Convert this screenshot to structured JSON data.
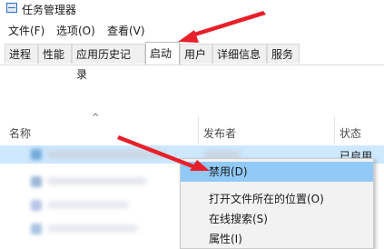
{
  "window": {
    "title": "任务管理器"
  },
  "menu": [
    "文件(F)",
    "选项(O)",
    "查看(V)"
  ],
  "tabs": [
    {
      "label": "进程",
      "active": false
    },
    {
      "label": "性能",
      "active": false
    },
    {
      "label": "应用历史记录",
      "active": false
    },
    {
      "label": "启动",
      "active": true
    },
    {
      "label": "用户",
      "active": false
    },
    {
      "label": "详细信息",
      "active": false
    },
    {
      "label": "服务",
      "active": false
    }
  ],
  "columns": {
    "name": "名称",
    "publisher": "发布者",
    "status": "状态"
  },
  "selected_row": {
    "status": "已启用"
  },
  "context_menu": {
    "items": [
      {
        "label": "禁用(D)",
        "highlighted": true
      },
      {
        "label": "打开文件所在的位置(O)",
        "highlighted": false
      },
      {
        "label": "在线搜索(S)",
        "highlighted": false
      },
      {
        "label": "属性(I)",
        "highlighted": false
      }
    ]
  },
  "colors": {
    "accent_arrow": "#e8202a",
    "selection": "#cde8ff",
    "menu_highlight": "#91c9f7"
  }
}
